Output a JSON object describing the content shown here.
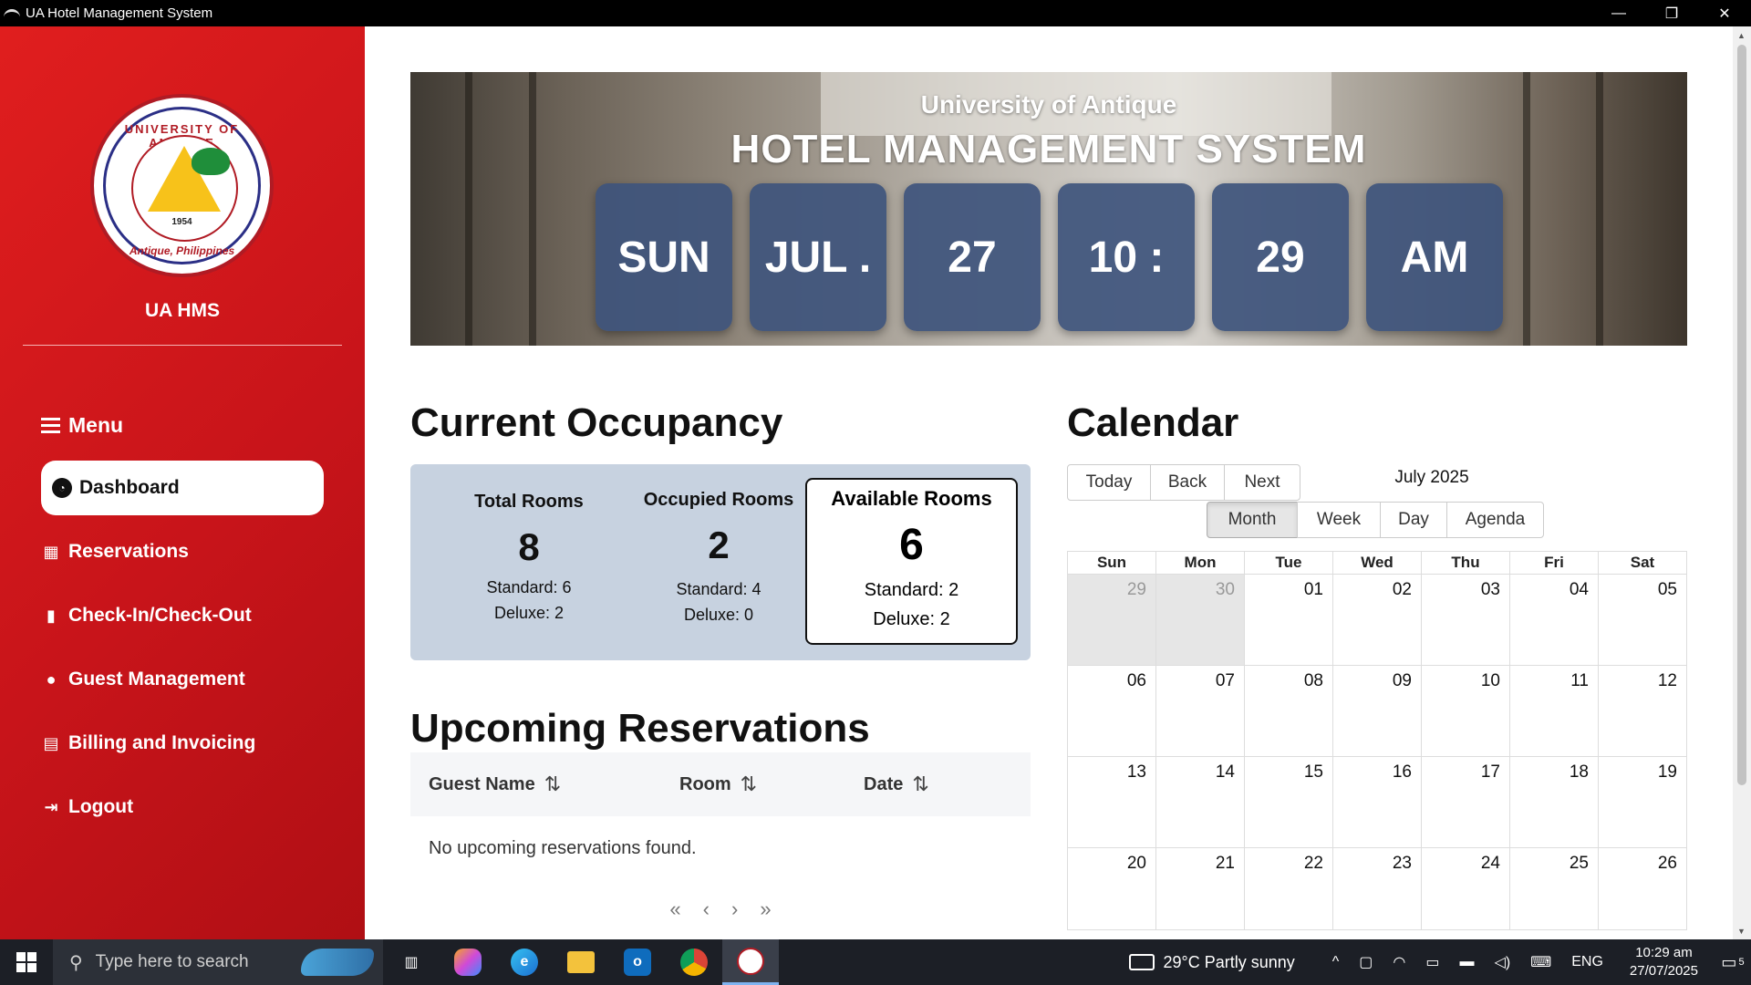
{
  "window": {
    "title": "UA Hotel Management System",
    "minimize": "—",
    "restore": "❐",
    "close": "✕"
  },
  "sidebar": {
    "logo": {
      "ring_top": "UNIVERSITY OF ANTIQUE",
      "year": "1954",
      "ring_bottom": "Antique, Philippines"
    },
    "brand": "UA HMS",
    "menu_label": "Menu",
    "items": [
      {
        "label": "Dashboard",
        "icon": "dashboard-icon"
      },
      {
        "label": "Reservations",
        "icon": "calendar-icon"
      },
      {
        "label": "Check-In/Check-Out",
        "icon": "door-icon"
      },
      {
        "label": "Guest Management",
        "icon": "users-icon"
      },
      {
        "label": "Billing and Invoicing",
        "icon": "cash-register-icon"
      },
      {
        "label": "Logout",
        "icon": "logout-icon"
      }
    ],
    "active_item": "Dashboard"
  },
  "banner": {
    "subtitle": "University of Antique",
    "title": "HOTEL MANAGEMENT SYSTEM",
    "clock": [
      "SUN",
      "JUL .",
      "27",
      "10 :",
      "29",
      "AM"
    ]
  },
  "occupancy": {
    "heading": "Current Occupancy",
    "total": {
      "label": "Total Rooms",
      "value": "8",
      "standard": "Standard: 6",
      "deluxe": "Deluxe: 2"
    },
    "occupied": {
      "label": "Occupied Rooms",
      "value": "2",
      "standard": "Standard: 4",
      "deluxe": "Deluxe: 0"
    },
    "available": {
      "label": "Available Rooms",
      "value": "6",
      "standard": "Standard: 2",
      "deluxe": "Deluxe: 2"
    }
  },
  "reservations": {
    "heading": "Upcoming Reservations",
    "columns": [
      "Guest Name",
      "Room",
      "Date"
    ],
    "sort_glyph": "⇅",
    "empty": "No upcoming reservations found.",
    "pager": [
      "«",
      "‹",
      "›",
      "»"
    ]
  },
  "calendar": {
    "heading": "Calendar",
    "nav": [
      "Today",
      "Back",
      "Next"
    ],
    "label": "July 2025",
    "views": [
      "Month",
      "Week",
      "Day",
      "Agenda"
    ],
    "active_view": "Month",
    "weekdays": [
      "Sun",
      "Mon",
      "Tue",
      "Wed",
      "Thu",
      "Fri",
      "Sat"
    ],
    "weeks": [
      [
        "29",
        "30",
        "01",
        "02",
        "03",
        "04",
        "05"
      ],
      [
        "06",
        "07",
        "08",
        "09",
        "10",
        "11",
        "12"
      ],
      [
        "13",
        "14",
        "15",
        "16",
        "17",
        "18",
        "19"
      ],
      [
        "20",
        "21",
        "22",
        "23",
        "24",
        "25",
        "26"
      ]
    ],
    "off_days": [
      "29",
      "30"
    ]
  },
  "taskbar": {
    "search_placeholder": "Type here to search",
    "apps": [
      "task-view-icon",
      "copilot-icon",
      "edge-icon",
      "file-explorer-icon",
      "outlook-icon",
      "chrome-icon",
      "ua-hms-app-icon"
    ],
    "weather": "29°C  Partly sunny",
    "language": "ENG",
    "time": "10:29 am",
    "date": "27/07/2025",
    "notifications": "5"
  }
}
